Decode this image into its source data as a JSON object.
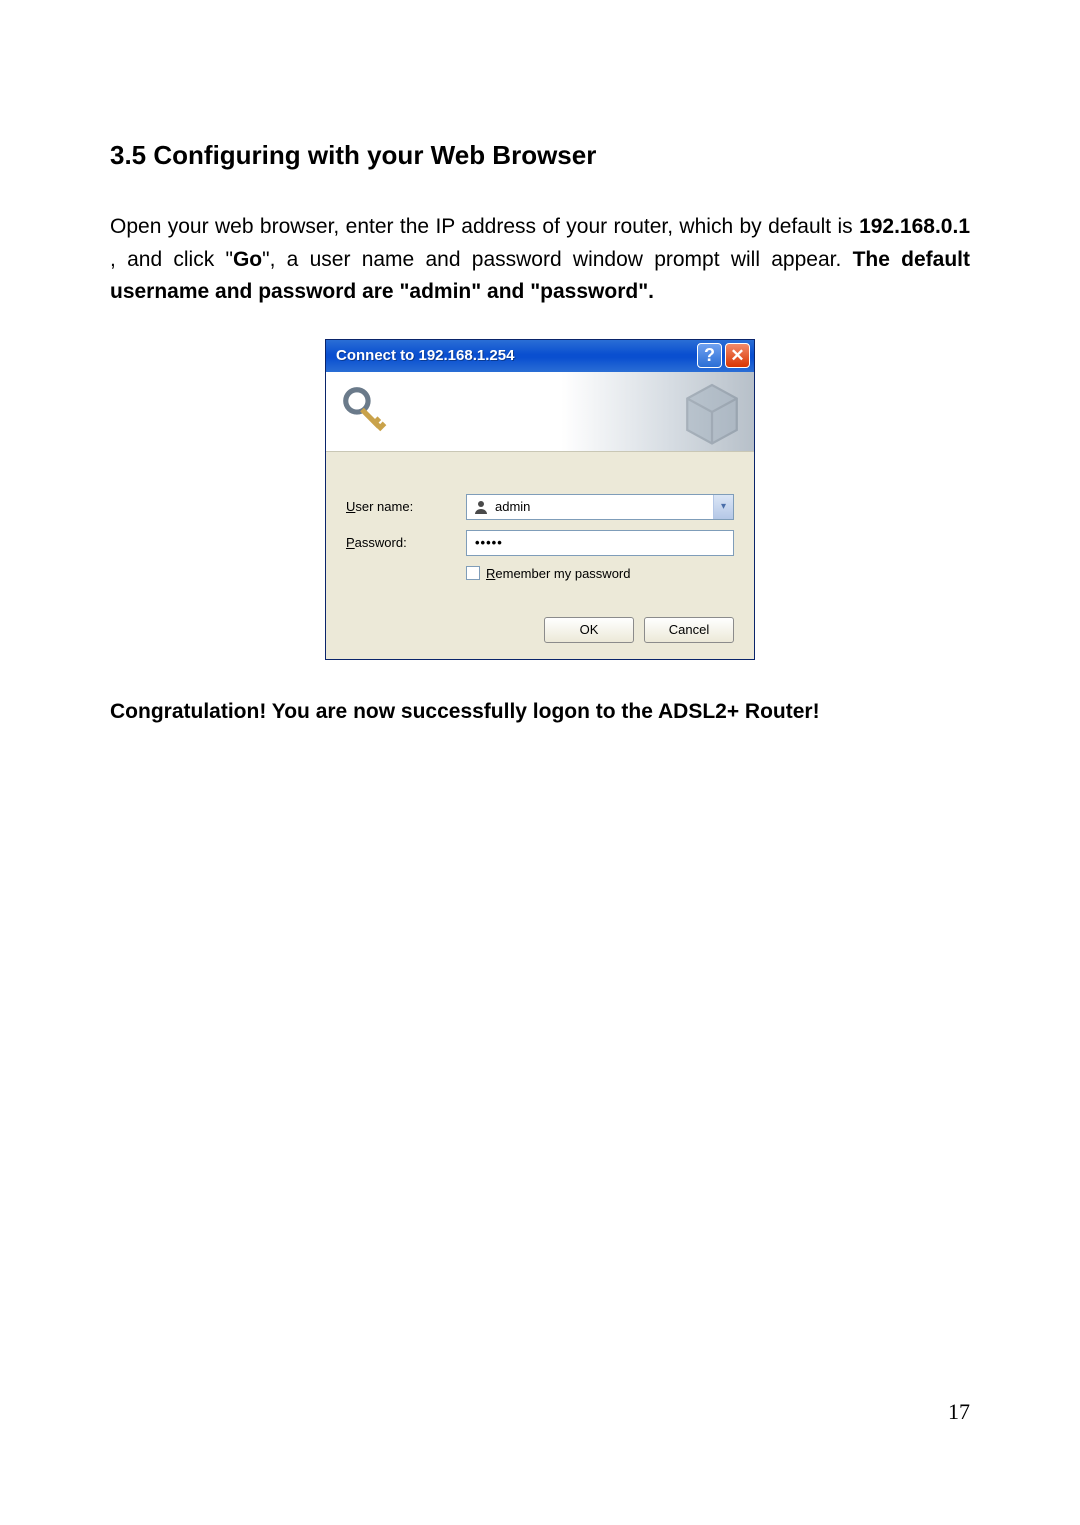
{
  "heading": "3.5 Configuring with your Web Browser",
  "para": {
    "p1_a": "Open your web browser, enter the IP address of your router, which by default is ",
    "ip": "192.168.0.1",
    "p1_b": " , and click \"",
    "go": "Go",
    "p1_c": "\", a user name and password window prompt will appear.    ",
    "p1_d": "The default username and password are \"admin\" and \"password\"."
  },
  "dialog": {
    "title": "Connect to 192.168.1.254",
    "help_glyph": "?",
    "close_glyph": "✕",
    "username_label_pre": "U",
    "username_label_post": "ser name:",
    "password_label_pre": "P",
    "password_label_post": "assword:",
    "username_value": "admin",
    "password_mask": "•••••",
    "dropdown_glyph": "▾",
    "remember_pre": "R",
    "remember_post": "emember my password",
    "ok": "OK",
    "cancel": "Cancel"
  },
  "congrats": "Congratulation! You are now successfully logon to the ADSL2+ Router!",
  "page_number": "17"
}
